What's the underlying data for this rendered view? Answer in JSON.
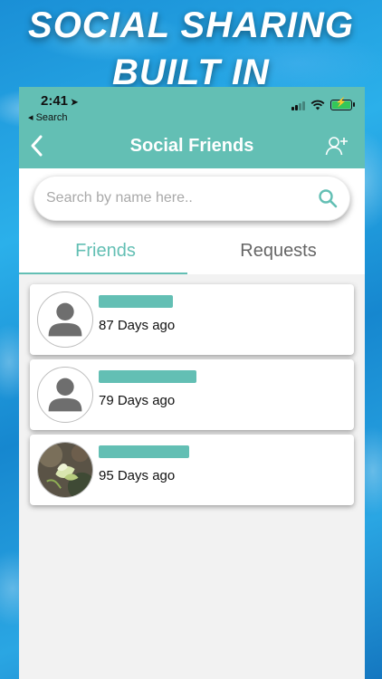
{
  "hero": {
    "line1": "SOCIAL SHARING",
    "line2": "BUILT IN"
  },
  "status_bar": {
    "time": "2:41",
    "back_app": "◂ Search"
  },
  "header": {
    "title": "Social Friends",
    "back_icon": "chevron-left-icon",
    "add_icon": "add-user-icon"
  },
  "search": {
    "placeholder": "Search by name here..",
    "icon": "search-icon"
  },
  "tabs": [
    {
      "label": "Friends",
      "active": true
    },
    {
      "label": "Requests",
      "active": false
    }
  ],
  "friends": [
    {
      "name": "",
      "time": "87 Days ago",
      "avatar": "default-avatar"
    },
    {
      "name": "",
      "time": "79 Days ago",
      "avatar": "default-avatar"
    },
    {
      "name": "",
      "time": "95 Days ago",
      "avatar": "photo-avatar"
    }
  ],
  "colors": {
    "accent": "#63bfb4",
    "background": "#f2f2f2",
    "tab_inactive": "#666666"
  }
}
